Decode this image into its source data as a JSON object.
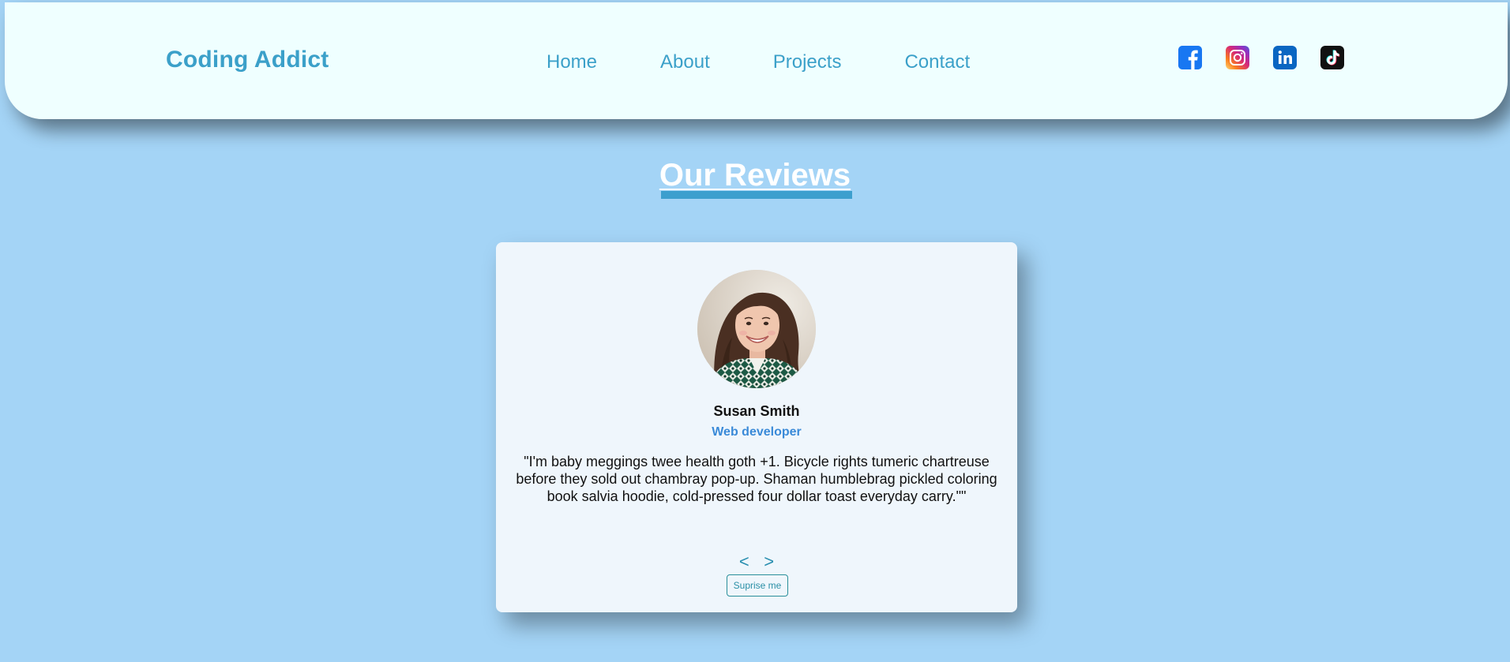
{
  "navbar": {
    "logo": "Coding Addict",
    "links": [
      {
        "label": "Home"
      },
      {
        "label": "About"
      },
      {
        "label": "Projects"
      },
      {
        "label": "Contact"
      }
    ],
    "socials": [
      {
        "icon": "facebook-icon"
      },
      {
        "icon": "instagram-icon"
      },
      {
        "icon": "linkedin-icon"
      },
      {
        "icon": "tiktok-icon"
      }
    ]
  },
  "section": {
    "title": "Our Reviews"
  },
  "review": {
    "name": "Susan Smith",
    "job": "Web developer",
    "text": "\"I'm baby meggings twee health goth +1. Bicycle rights tumeric chartreuse before they sold out chambray pop-up. Shaman humblebrag pickled coloring book salvia hoodie, cold-pressed four dollar toast everyday carry.\"\"",
    "prev_label": "<",
    "next_label": ">",
    "surprise_label": "Suprise me"
  },
  "colors": {
    "background": "#a4d4f6",
    "navbar_bg": "#efffff",
    "accent": "#3ba0c9",
    "card_bg": "#eff6fc",
    "job_color": "#3a8ad8"
  }
}
